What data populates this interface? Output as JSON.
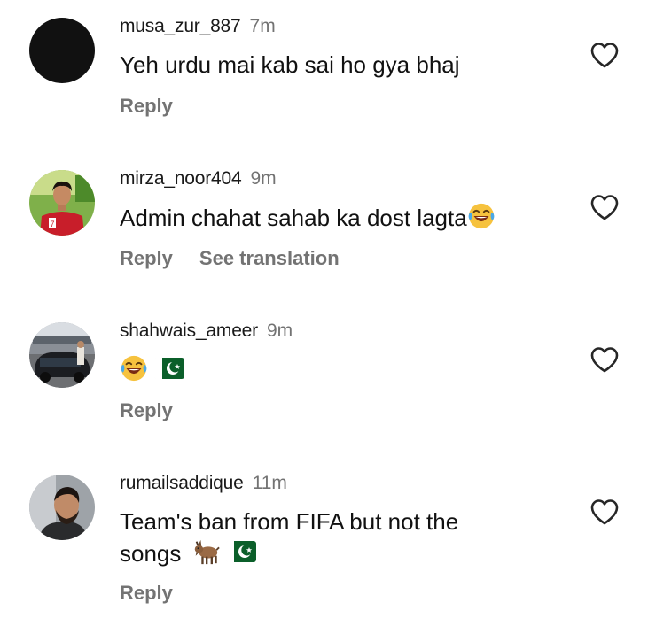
{
  "comments": [
    {
      "username": "musa_zur_887",
      "time": "7m",
      "text": "Yeh urdu mai kab sai ho gya bhaj",
      "reply_label": "Reply",
      "avatar": "black-avatar"
    },
    {
      "username": "mirza_noor404",
      "time": "9m",
      "text": "Admin chahat sahab ka dost lagta",
      "emojis": [
        "laughing-tears-emoji"
      ],
      "reply_label": "Reply",
      "translate_label": "See translation",
      "avatar": "person-red-shirt-avatar"
    },
    {
      "username": "shahwais_ameer",
      "time": "9m",
      "text": "",
      "emojis": [
        "laughing-tears-emoji",
        "pakistan-flag-emoji"
      ],
      "reply_label": "Reply",
      "avatar": "car-photo-avatar"
    },
    {
      "username": "rumailsaddique",
      "time": "11m",
      "text_line1": "Team's ban from FIFA but not the",
      "text_line2": "songs",
      "emojis": [
        "goat-emoji",
        "pakistan-flag-emoji"
      ],
      "reply_label": "Reply",
      "avatar": "bearded-man-avatar"
    }
  ],
  "colors": {
    "text": "#111111",
    "muted": "#737373",
    "background": "#ffffff"
  },
  "icons": {
    "like": "heart-outline-icon"
  }
}
